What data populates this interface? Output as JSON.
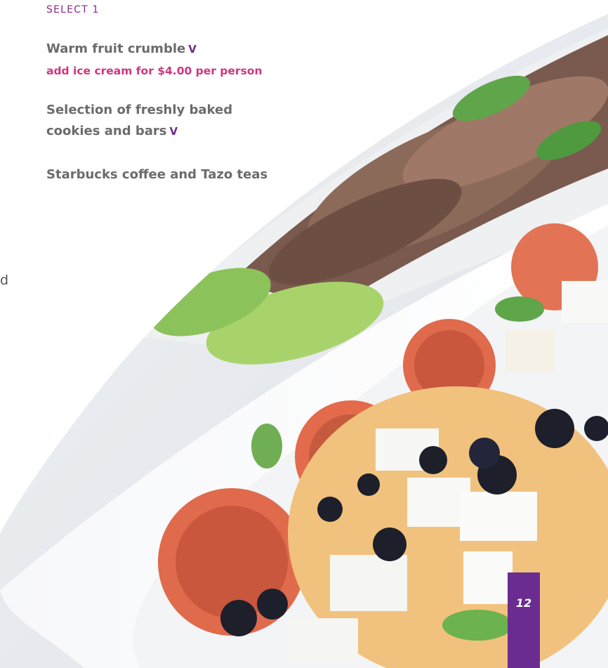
{
  "menu": {
    "select_heading": "SELECT 1",
    "items": [
      {
        "name": "Warm fruit crumble",
        "marker": "V"
      },
      {
        "addon": "add ice cream for $4.00 per person"
      },
      {
        "line1": "Selection of freshly baked",
        "line2": "cookies and bars",
        "marker": "V"
      },
      {
        "name": "Starbucks coffee and Tazo teas"
      }
    ]
  },
  "stray_text": "d",
  "page_number": "12",
  "colors": {
    "accent_purple": "#6b2c91",
    "accent_pink": "#d1357f",
    "body_gray": "#6b6b6b"
  }
}
